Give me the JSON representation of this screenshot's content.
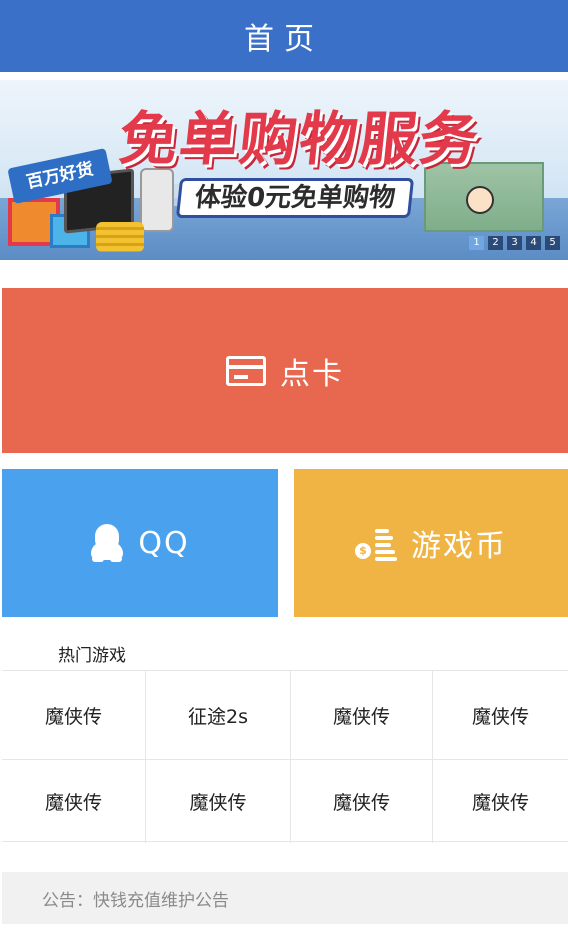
{
  "header": {
    "title": "首页"
  },
  "banner": {
    "headline": "免单购物服务",
    "subline": "体验0元免单购物",
    "tag": "百万好货",
    "pages": [
      "1",
      "2",
      "3",
      "4",
      "5"
    ],
    "active_page": "1"
  },
  "tiles": {
    "card": {
      "label": "点卡",
      "icon": "card-icon",
      "color": "#e8674f"
    },
    "qq": {
      "label": "QQ",
      "icon": "qq-penguin-icon",
      "color": "#4aa2ef"
    },
    "coin": {
      "label": "游戏币",
      "icon": "coins-icon",
      "color": "#f0b445"
    }
  },
  "hot_games": {
    "title": "热门游戏",
    "rows": [
      [
        "魔侠传",
        "征途2s",
        "魔侠传",
        "魔侠传"
      ],
      [
        "魔侠传",
        "魔侠传",
        "魔侠传",
        "魔侠传"
      ]
    ]
  },
  "notice": {
    "text": "公告：快钱充值维护公告"
  },
  "colors": {
    "header": "#3a70c8",
    "notice_bg": "#f1f1f1"
  }
}
